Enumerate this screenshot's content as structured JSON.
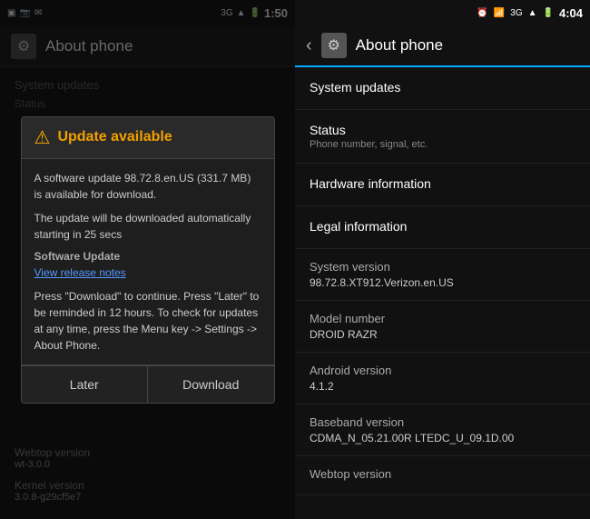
{
  "left_panel": {
    "status_bar": {
      "network": "3G",
      "signal": "▲▲▲",
      "battery": "■",
      "time": "1:50"
    },
    "header": {
      "title": "About phone"
    },
    "content": {
      "system_updates": "System updates",
      "status_label": "Status"
    },
    "dialog": {
      "title": "Update available",
      "message1": "A software update 98.72.8.en.US (331.7 MB) is available for download.",
      "message2": "The update will be downloaded automatically starting in 25 secs",
      "software_update_label": "Software Update",
      "view_release_notes": "View release notes",
      "instructions": "Press \"Download\" to continue. Press \"Later\" to be reminded in 12 hours. To check for updates at any time, press the Menu key -> Settings -> About Phone.",
      "btn_later": "Later",
      "btn_download": "Download"
    },
    "bottom": {
      "webtop_label": "Webtop version",
      "webtop_value": "wt-3.0.0",
      "kernel_label": "Kernel version",
      "kernel_value": "3.0.8-g29cf5e7"
    }
  },
  "right_panel": {
    "status_bar": {
      "time": "4:04"
    },
    "header": {
      "title": "About phone"
    },
    "menu_items": [
      {
        "label": "System updates",
        "sub": ""
      },
      {
        "label": "Status",
        "sub": "Phone number, signal, etc."
      },
      {
        "label": "Hardware information",
        "sub": ""
      },
      {
        "label": "Legal information",
        "sub": ""
      }
    ],
    "info_rows": [
      {
        "label": "System version",
        "value": "98.72.8.XT912.Verizon.en.US"
      },
      {
        "label": "Model number",
        "value": "DROID RAZR"
      },
      {
        "label": "Android version",
        "value": "4.1.2"
      },
      {
        "label": "Baseband version",
        "value": "CDMA_N_05.21.00R LTEDC_U_09.1D.00"
      },
      {
        "label": "Webtop version",
        "value": ""
      }
    ]
  }
}
